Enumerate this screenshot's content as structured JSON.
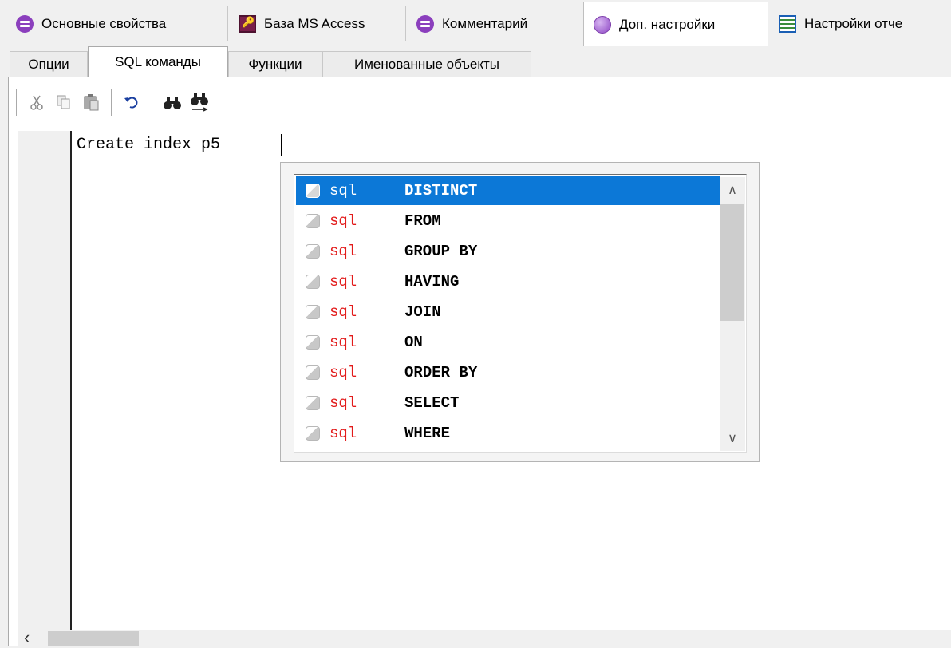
{
  "top_tabs": [
    {
      "label": "Основные свойства",
      "icon": "database-icon"
    },
    {
      "label": "База MS Access",
      "icon": "access-key-icon"
    },
    {
      "label": "Комментарий",
      "icon": "database-icon"
    },
    {
      "label": "Доп. настройки",
      "icon": "globe-icon",
      "active": true
    },
    {
      "label": "Настройки отче",
      "icon": "report-icon"
    }
  ],
  "sub_tabs": [
    {
      "label": "Опции"
    },
    {
      "label": "SQL команды",
      "active": true
    },
    {
      "label": "Функции"
    },
    {
      "label": "Именованные объекты"
    }
  ],
  "toolbar": {
    "buttons": [
      "cut-icon",
      "copy-icon",
      "paste-icon",
      "undo-icon",
      "find-icon",
      "replace-icon"
    ]
  },
  "editor": {
    "text": "Create index p5 "
  },
  "autocomplete": {
    "selected_index": 0,
    "items": [
      {
        "kind": "sql",
        "keyword": "DISTINCT"
      },
      {
        "kind": "sql",
        "keyword": "FROM"
      },
      {
        "kind": "sql",
        "keyword": "GROUP BY"
      },
      {
        "kind": "sql",
        "keyword": "HAVING"
      },
      {
        "kind": "sql",
        "keyword": "JOIN"
      },
      {
        "kind": "sql",
        "keyword": "ON"
      },
      {
        "kind": "sql",
        "keyword": "ORDER BY"
      },
      {
        "kind": "sql",
        "keyword": "SELECT"
      },
      {
        "kind": "sql",
        "keyword": "WHERE"
      }
    ]
  },
  "colors": {
    "selection": "#0c78d7",
    "kind_text": "#e21b1b"
  }
}
